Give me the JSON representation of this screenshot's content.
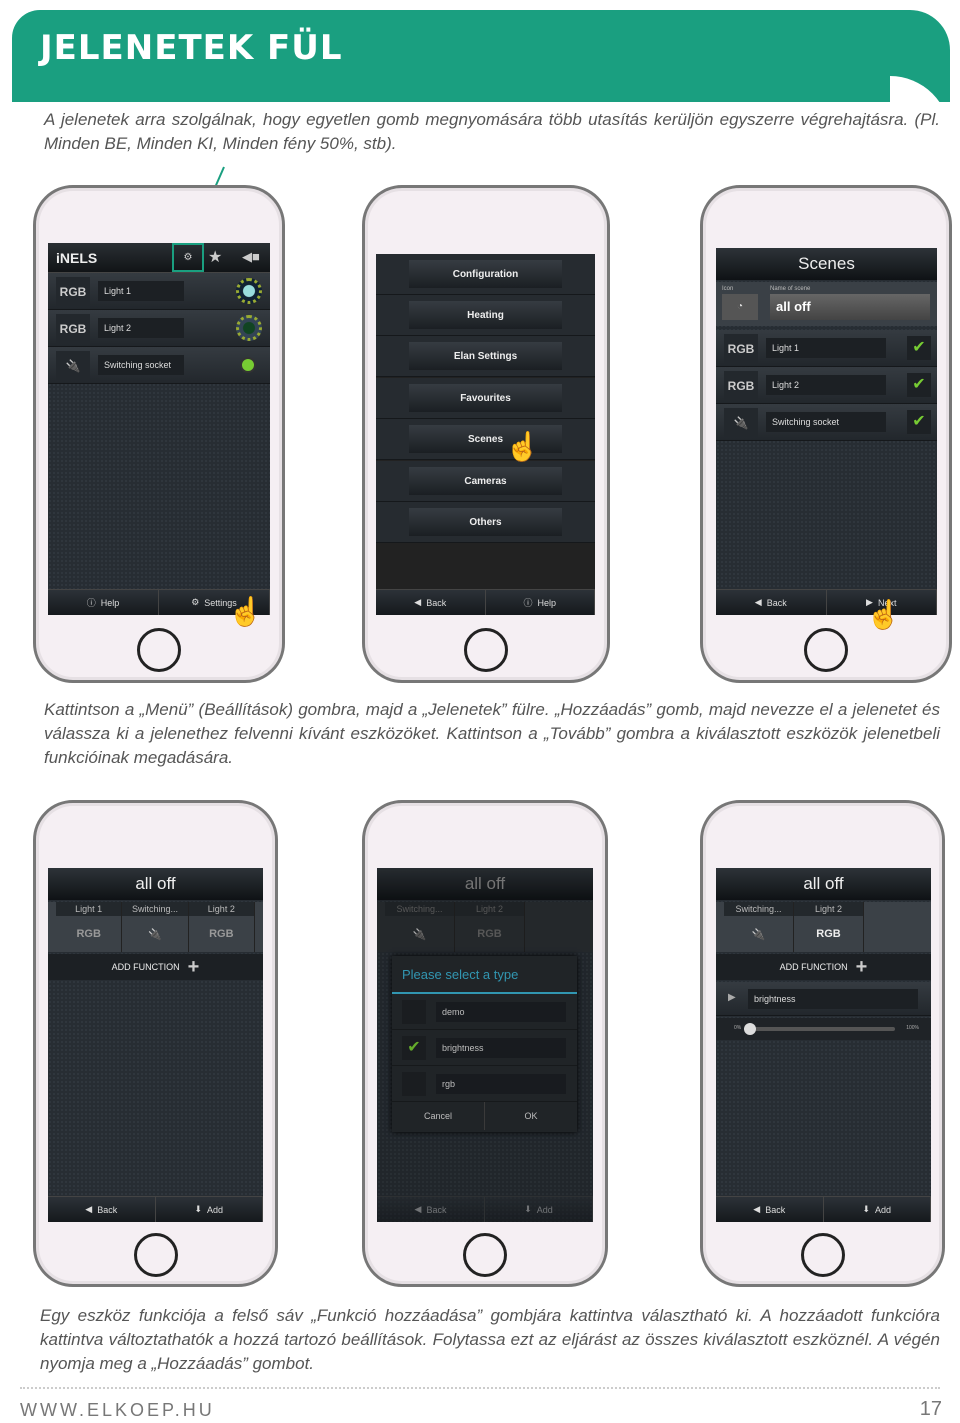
{
  "header": {
    "title": "JELENETEK FÜL",
    "accent": "#1a9f80"
  },
  "intro": "A jelenetek arra szolgálnak, hogy egyetlen gomb megnyomására több utasítás kerüljön egyszerre végrehajtásra. (Pl. Minden BE, Minden KI, Minden fény 50%, stb).",
  "step1": "Kattintson a „Menü” (Beállítások) gombra, majd a „Jelenetek” fülre. „Hozzáadás” gomb, majd nevezze el a jelenetet és válassza ki a jelenethez felvenni kívánt eszközöket. Kattintson a „Tovább” gombra a kiválasztott eszközök jelenetbeli funkcióinak megadására.",
  "step2": "Egy eszköz funkciója a felső sáv „Funkció hozzáadása” gombjára kattintva választható ki.  A hozzáadott funkcióra kattintva változtathatók a hozzá tartozó beállítások. Folytassa ezt az eljárást az összes kiválasztott eszköznél. A végén nyomja meg a „Hozzáadás” gombot.",
  "screen1": {
    "logo": "iNELS",
    "tab_icons": [
      "settings-icon",
      "star-icon",
      "camera-icon"
    ],
    "devices": [
      {
        "type": "RGB",
        "name": "Light 1",
        "state": "on"
      },
      {
        "type": "RGB",
        "name": "Light 2",
        "state": "off"
      },
      {
        "type": "socket-icon",
        "name": "Switching socket",
        "state": "on"
      }
    ],
    "bottom": [
      "Help",
      "Settings"
    ]
  },
  "screen2": {
    "menu": [
      "Configuration",
      "Heating",
      "Elan Settings",
      "Favourites",
      "Scenes",
      "Cameras",
      "Others"
    ],
    "bottom": [
      "Back",
      "Help"
    ]
  },
  "screen3": {
    "title": "Scenes",
    "icon_label": "Icon",
    "name_label": "Name of scene",
    "name_value": "all off",
    "devices": [
      {
        "type": "RGB",
        "name": "Light 1",
        "checked": true
      },
      {
        "type": "RGB",
        "name": "Light 2",
        "checked": true
      },
      {
        "type": "socket-icon",
        "name": "Switching socket",
        "checked": true
      }
    ],
    "bottom": [
      "Back",
      "Next"
    ]
  },
  "screen4": {
    "title": "all off",
    "tabs": [
      {
        "label": "Light 1",
        "type": "RGB"
      },
      {
        "label": "Switching...",
        "type": "socket-icon"
      },
      {
        "label": "Light 2",
        "type": "RGB"
      }
    ],
    "add_function": "ADD FUNCTION",
    "bottom": [
      "Back",
      "Add"
    ]
  },
  "screen5": {
    "title": "all off",
    "tabs": [
      {
        "label": "Switching...",
        "type": "socket-icon"
      },
      {
        "label": "Light 2",
        "type": "RGB"
      }
    ],
    "dialog": {
      "title": "Please select a type",
      "options": [
        {
          "label": "demo",
          "checked": false
        },
        {
          "label": "brightness",
          "checked": true
        },
        {
          "label": "rgb",
          "checked": false
        }
      ],
      "cancel": "Cancel",
      "ok": "OK"
    },
    "bottom": [
      "Back",
      "Add"
    ]
  },
  "screen6": {
    "title": "all off",
    "tabs": [
      {
        "label": "Switching...",
        "type": "socket-icon"
      },
      {
        "label": "Light 2",
        "type": "RGB"
      }
    ],
    "add_function": "ADD FUNCTION",
    "function": "brightness",
    "slider": {
      "min": "0%",
      "max": "100%",
      "value_percent": 3
    },
    "bottom": [
      "Back",
      "Add"
    ]
  },
  "footer": {
    "url": "WWW.ELKOEP.HU",
    "page": "17"
  }
}
